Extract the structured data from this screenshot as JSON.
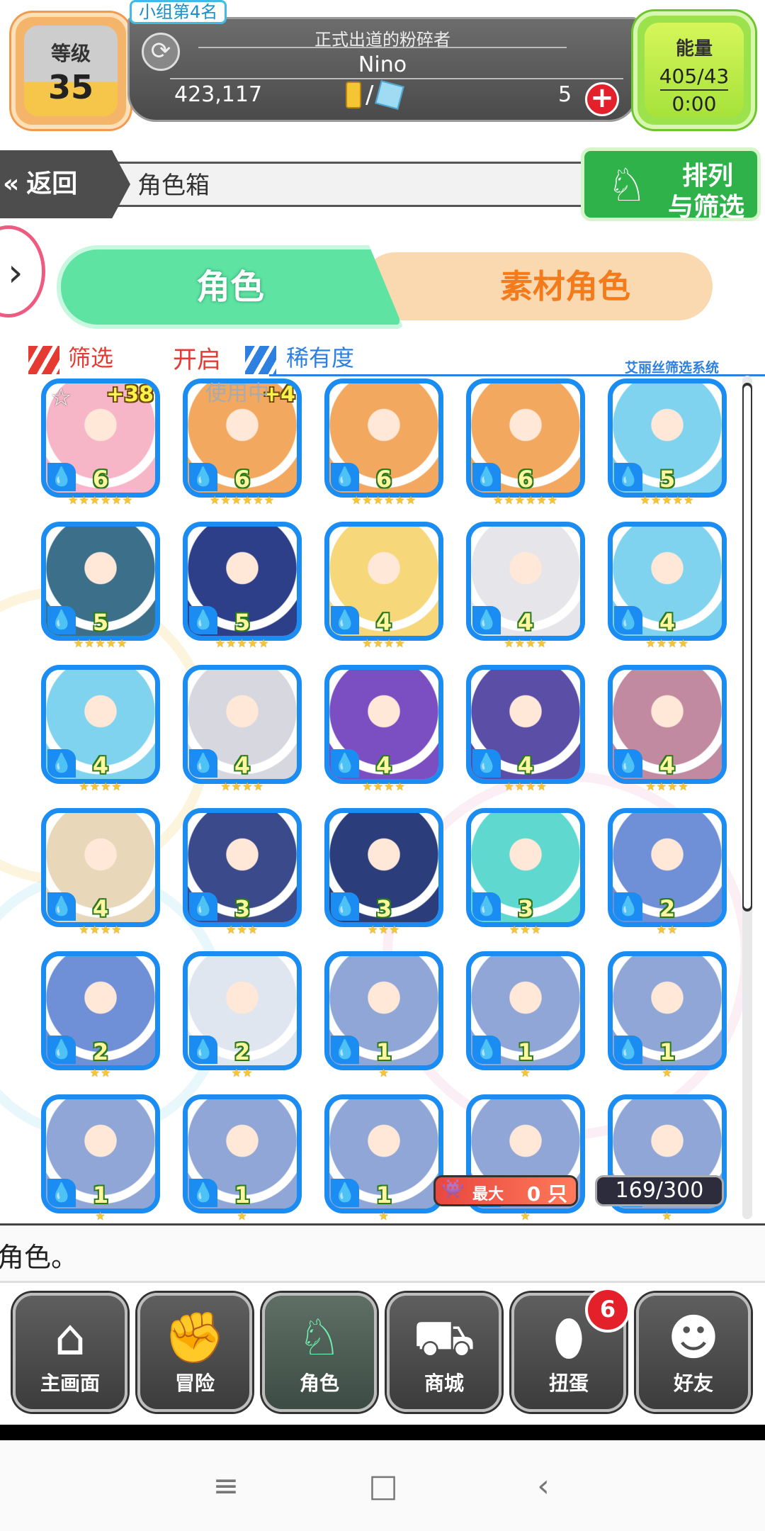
{
  "header": {
    "level_label": "等级",
    "level_value": "35",
    "group_rank": "小组第4名",
    "player_title": "正式出道的粉碎者",
    "player_name": "Nino",
    "gold": "423,117",
    "coin_separator": "/",
    "gems": "5",
    "energy_label": "能量",
    "energy_value": "405/43",
    "energy_timer": "0:00",
    "icons": [
      "refresh-icon",
      "gold-coin-icon",
      "ice-crystal-icon",
      "add-icon"
    ]
  },
  "nav": {
    "back_label": "返回",
    "back_icon": "«",
    "page_title": "角色箱",
    "sort_label_1": "排列",
    "sort_label_2": "与筛选"
  },
  "tabs": {
    "character": "角色",
    "material": "素材角色"
  },
  "filter": {
    "filter_label": "筛选",
    "filter_value": "开启",
    "sort_by": "稀有度",
    "system_name": "艾丽丝筛选系统",
    "in_use": "使用中"
  },
  "grid": {
    "cards": [
      {
        "level": "6",
        "stars": 6,
        "plus": "+38",
        "favorite": true,
        "theme": "#f7b6c8"
      },
      {
        "level": "6",
        "stars": 6,
        "plus": "+4",
        "favorite": false,
        "theme": "#f3a860"
      },
      {
        "level": "6",
        "stars": 6,
        "plus": "",
        "favorite": false,
        "theme": "#f3a860"
      },
      {
        "level": "6",
        "stars": 6,
        "plus": "",
        "favorite": false,
        "theme": "#f3a860"
      },
      {
        "level": "5",
        "stars": 5,
        "plus": "",
        "favorite": false,
        "theme": "#7fd3ee"
      },
      {
        "level": "5",
        "stars": 5,
        "plus": "",
        "favorite": false,
        "theme": "#3c6f8a"
      },
      {
        "level": "5",
        "stars": 5,
        "plus": "",
        "favorite": false,
        "theme": "#2e3f8a"
      },
      {
        "level": "4",
        "stars": 4,
        "plus": "",
        "favorite": false,
        "theme": "#f6d77a"
      },
      {
        "level": "4",
        "stars": 4,
        "plus": "",
        "favorite": false,
        "theme": "#e6e6ea"
      },
      {
        "level": "4",
        "stars": 4,
        "plus": "",
        "favorite": false,
        "theme": "#7fd3ee"
      },
      {
        "level": "4",
        "stars": 4,
        "plus": "",
        "favorite": false,
        "theme": "#7fd3ee"
      },
      {
        "level": "4",
        "stars": 4,
        "plus": "",
        "favorite": false,
        "theme": "#d7d7e0"
      },
      {
        "level": "4",
        "stars": 4,
        "plus": "",
        "favorite": false,
        "theme": "#7b4fc2"
      },
      {
        "level": "4",
        "stars": 4,
        "plus": "",
        "favorite": false,
        "theme": "#5a4ea6"
      },
      {
        "level": "4",
        "stars": 4,
        "plus": "",
        "favorite": false,
        "theme": "#c28aa0"
      },
      {
        "level": "4",
        "stars": 4,
        "plus": "",
        "favorite": false,
        "theme": "#e8d7b8"
      },
      {
        "level": "3",
        "stars": 3,
        "plus": "",
        "favorite": false,
        "theme": "#3a4a8a"
      },
      {
        "level": "3",
        "stars": 3,
        "plus": "",
        "favorite": false,
        "theme": "#2b3d7a"
      },
      {
        "level": "3",
        "stars": 3,
        "plus": "",
        "favorite": false,
        "theme": "#5fd9cf"
      },
      {
        "level": "2",
        "stars": 2,
        "plus": "",
        "favorite": false,
        "theme": "#6f8fd6"
      },
      {
        "level": "2",
        "stars": 2,
        "plus": "",
        "favorite": false,
        "theme": "#6f8fd6"
      },
      {
        "level": "2",
        "stars": 2,
        "plus": "",
        "favorite": false,
        "theme": "#dfe6ef"
      },
      {
        "level": "1",
        "stars": 1,
        "plus": "",
        "favorite": false,
        "theme": "#8fa6d6"
      },
      {
        "level": "1",
        "stars": 1,
        "plus": "",
        "favorite": false,
        "theme": "#8fa6d6"
      },
      {
        "level": "1",
        "stars": 1,
        "plus": "",
        "favorite": false,
        "theme": "#8fa6d6"
      },
      {
        "level": "1",
        "stars": 1,
        "plus": "",
        "favorite": false,
        "theme": "#8fa6d6"
      },
      {
        "level": "1",
        "stars": 1,
        "plus": "",
        "favorite": false,
        "theme": "#8fa6d6"
      },
      {
        "level": "1",
        "stars": 1,
        "plus": "",
        "favorite": false,
        "theme": "#8fa6d6"
      },
      {
        "level": "",
        "stars": 1,
        "plus": "",
        "favorite": false,
        "theme": "#8fa6d6"
      },
      {
        "level": "",
        "stars": 1,
        "plus": "",
        "favorite": false,
        "theme": "#8fa6d6"
      }
    ],
    "max_label": "最大",
    "max_value": "0 只",
    "count": "169/300"
  },
  "message": "角色。",
  "bottom_nav": [
    {
      "label": "主画面",
      "icon": "home-icon",
      "glyph": "⌂"
    },
    {
      "label": "冒险",
      "icon": "handshake-icon",
      "glyph": "✊"
    },
    {
      "label": "角色",
      "icon": "rabbit-icon",
      "glyph": "♘"
    },
    {
      "label": "商城",
      "icon": "cart-icon",
      "glyph": "⛟"
    },
    {
      "label": "扭蛋",
      "icon": "egg-icon",
      "glyph": "⬮"
    },
    {
      "label": "好友",
      "icon": "friends-icon",
      "glyph": "☻"
    }
  ],
  "gacha_badge": "6",
  "system_nav": {
    "menu": "≡",
    "home": "□",
    "back": "‹"
  },
  "colors": {
    "accent_blue": "#1b8df2",
    "tab_green": "#5ee3a3",
    "tab_orange": "#f47b1c",
    "filter_red": "#e53a32",
    "sort_green": "#2fb24a"
  }
}
